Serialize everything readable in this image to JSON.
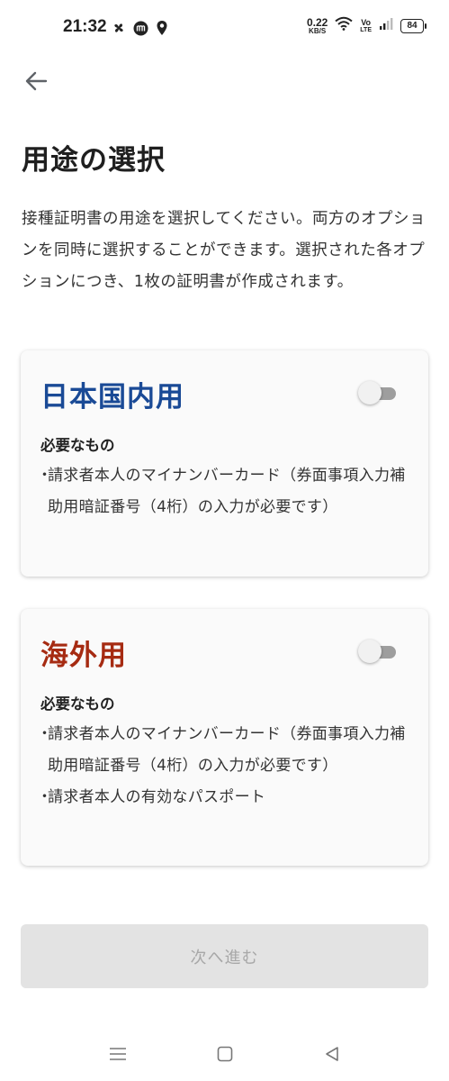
{
  "status_bar": {
    "time": "21:32",
    "net_speed_value": "0.22",
    "net_speed_unit": "KB/S",
    "volte_top": "Vo",
    "volte_bottom": "LTE",
    "battery_level": "84"
  },
  "page": {
    "title": "用途の選択",
    "description": "接種証明書の用途を選択してください。両方のオプションを同時に選択することができます。選択された各オプションにつき、1枚の証明書が作成されます。"
  },
  "options": [
    {
      "title": "日本国内用",
      "toggle_on": false,
      "requirements_heading": "必要なもの",
      "requirements": [
        "請求者本人のマイナンバーカード（券面事項入力補助用暗証番号（4桁）の入力が必要です）"
      ]
    },
    {
      "title": "海外用",
      "toggle_on": false,
      "requirements_heading": "必要なもの",
      "requirements": [
        "請求者本人のマイナンバーカード（券面事項入力補助用暗証番号（4桁）の入力が必要です）",
        "請求者本人の有効なパスポート"
      ]
    }
  ],
  "actions": {
    "next_label": "次へ進む"
  },
  "colors": {
    "domestic_title": "#1a4a96",
    "overseas_title": "#a62b12",
    "button_disabled_bg": "#e3e3e3",
    "button_disabled_text": "#a8a8a8"
  },
  "icons": {
    "back": "arrow-left-icon",
    "status_left": [
      "pinwheel-icon",
      "m-badge-icon",
      "location-pin-icon"
    ],
    "status_right": [
      "wifi-icon",
      "signal-icon",
      "battery-icon"
    ],
    "nav": [
      "menu-icon",
      "home-square-icon",
      "back-triangle-icon"
    ]
  }
}
